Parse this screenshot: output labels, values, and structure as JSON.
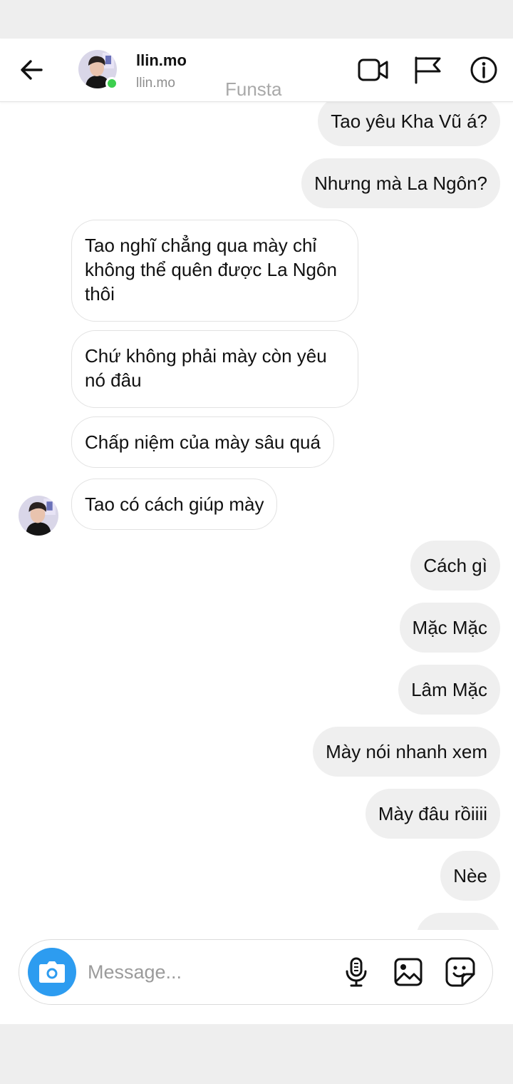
{
  "header": {
    "name": "llin.mo",
    "username": "llin.mo",
    "watermark": "Funsta",
    "icons": {
      "back": "arrow-left-icon",
      "video": "video-camera-icon",
      "flag": "flag-icon",
      "info": "info-icon"
    },
    "online_color": "#3ccf4e"
  },
  "messages": [
    {
      "side": "out",
      "text": "Tao yêu Kha Vũ á?"
    },
    {
      "side": "out",
      "text": "Nhưng mà La Ngôn?"
    },
    {
      "side": "in",
      "text": "Tao nghĩ chẳng qua mày chỉ không thể quên được La Ngôn thôi"
    },
    {
      "side": "in",
      "text": "Chứ không phải mày còn yêu nó đâu"
    },
    {
      "side": "in",
      "text": "Chấp niệm của mày sâu quá"
    },
    {
      "side": "in",
      "text": "Tao có cách giúp mày"
    },
    {
      "side": "out",
      "text": "Cách gì"
    },
    {
      "side": "out",
      "text": "Mặc Mặc"
    },
    {
      "side": "out",
      "text": "Lâm Mặc"
    },
    {
      "side": "out",
      "text": "Mày nói nhanh xem"
    },
    {
      "side": "out",
      "text": "Mày đâu rồiiii"
    },
    {
      "side": "out",
      "text": "Nèe"
    }
  ],
  "composer": {
    "placeholder": "Message...",
    "icons": {
      "camera": "camera-icon",
      "mic": "microphone-icon",
      "gallery": "image-icon",
      "sticker": "sticker-icon"
    },
    "camera_color": "#2d9cf0"
  },
  "colors": {
    "outgoing_bubble": "#efefef",
    "incoming_bubble": "#ffffff",
    "incoming_border": "#e2e2e2"
  }
}
